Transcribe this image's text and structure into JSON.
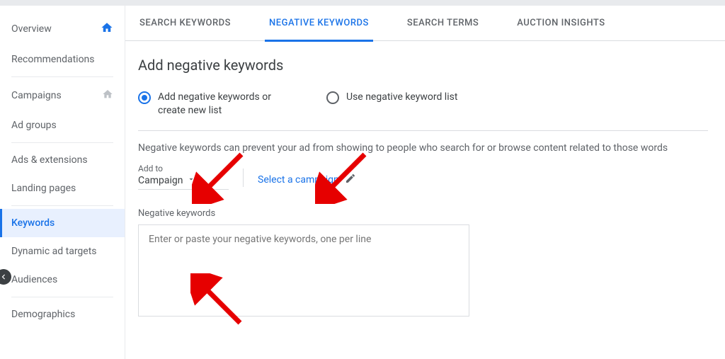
{
  "sidebar": {
    "items": [
      {
        "label": "Overview"
      },
      {
        "label": "Recommendations"
      },
      {
        "label": "Campaigns"
      },
      {
        "label": "Ad groups"
      },
      {
        "label": "Ads & extensions"
      },
      {
        "label": "Landing pages"
      },
      {
        "label": "Keywords"
      },
      {
        "label": "Dynamic ad targets"
      },
      {
        "label": "Audiences"
      },
      {
        "label": "Demographics"
      }
    ]
  },
  "tabs": [
    {
      "label": "SEARCH KEYWORDS"
    },
    {
      "label": "NEGATIVE KEYWORDS"
    },
    {
      "label": "SEARCH TERMS"
    },
    {
      "label": "AUCTION INSIGHTS"
    }
  ],
  "page": {
    "title": "Add negative keywords",
    "radio_option_1": "Add negative keywords or create new list",
    "radio_option_2": "Use negative keyword list",
    "description": "Negative keywords can prevent your ad from showing to people who search for or browse content related to those words",
    "addto_label": "Add to",
    "addto_value": "Campaign",
    "select_campaign": "Select a campaign",
    "textarea_label": "Negative keywords",
    "textarea_placeholder": "Enter or paste your negative keywords, one per line"
  }
}
